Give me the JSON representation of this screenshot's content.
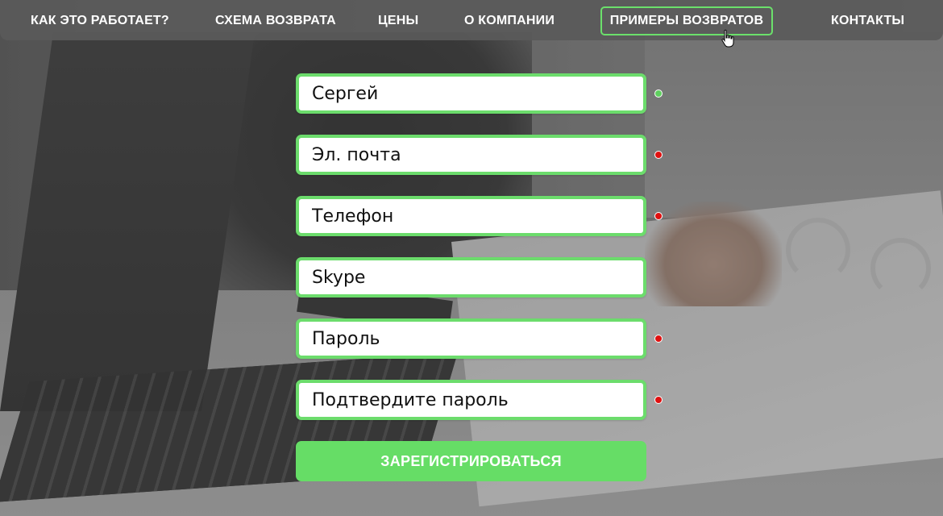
{
  "nav": {
    "items": [
      {
        "label": "КАК ЭТО РАБОТАЕТ?"
      },
      {
        "label": "СХЕМА ВОЗВРАТА"
      },
      {
        "label": "ЦЕНЫ"
      },
      {
        "label": "О КОМПАНИИ"
      },
      {
        "label": "ПРИМЕРЫ ВОЗВРАТОВ",
        "active": true
      },
      {
        "label": "КОНТАКТЫ"
      }
    ],
    "active_color": "#6be06b"
  },
  "form": {
    "fields": [
      {
        "name": "name",
        "value": "Сергей",
        "placeholder": "",
        "status": "valid"
      },
      {
        "name": "email",
        "value": "",
        "placeholder": "Эл. почта",
        "status": "invalid"
      },
      {
        "name": "phone",
        "value": "",
        "placeholder": "Телефон",
        "status": "invalid"
      },
      {
        "name": "skype",
        "value": "",
        "placeholder": "Skype",
        "status": "none"
      },
      {
        "name": "password",
        "value": "",
        "placeholder": "Пароль",
        "status": "invalid"
      },
      {
        "name": "password_confirm",
        "value": "",
        "placeholder": "Подтвердите пароль",
        "status": "invalid"
      }
    ],
    "submit_label": "ЗАРЕГИСТРИРОВАТЬСЯ"
  },
  "colors": {
    "accent": "#66dd66",
    "field_border": "#6cdc6c",
    "status_valid": "#5fd05f",
    "status_invalid": "#e01010"
  },
  "icons": {
    "cursor": "hand-pointer-icon"
  }
}
